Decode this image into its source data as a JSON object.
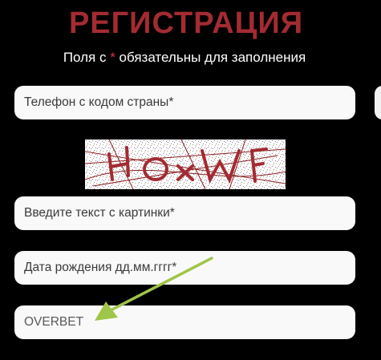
{
  "header": {
    "title": "РЕГИСТРАЦИЯ",
    "required_note_prefix": "Поля с ",
    "required_note_star": "*",
    "required_note_suffix": " обязательны для заполнения"
  },
  "form": {
    "phone_placeholder": "Телефон с кодом страны*",
    "captcha_text": "HOxWF",
    "captcha_input_placeholder": "Введите текст с картинки*",
    "birthdate_placeholder": "Дата рождения дд.мм.гггг*",
    "promo_value": "OVERBET"
  },
  "colors": {
    "title": "#a32b32",
    "required_star": "#e0303a",
    "arrow": "#9fc54a",
    "background": "#000000"
  },
  "annotation": {
    "icon": "arrow-pointer-icon"
  }
}
